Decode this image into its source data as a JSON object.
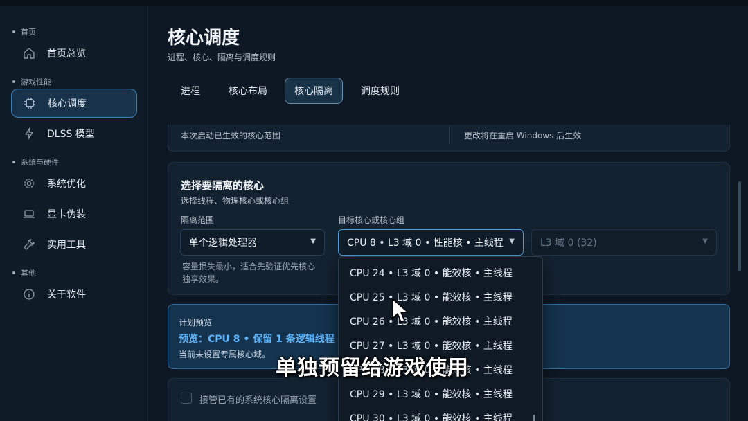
{
  "sidebar": {
    "sections": [
      {
        "label": "首页"
      },
      {
        "label": "游戏性能"
      },
      {
        "label": "系统与硬件"
      },
      {
        "label": "其他"
      }
    ],
    "items": [
      {
        "label": "首页总览",
        "icon": "home-icon"
      },
      {
        "label": "核心调度",
        "icon": "chip-icon"
      },
      {
        "label": "DLSS 模型",
        "icon": "lightning-icon"
      },
      {
        "label": "系统优化",
        "icon": "gear-icon"
      },
      {
        "label": "显卡伪装",
        "icon": "laptop-icon"
      },
      {
        "label": "实用工具",
        "icon": "wrench-icon"
      },
      {
        "label": "关于软件",
        "icon": "info-icon"
      }
    ],
    "active_index": 1
  },
  "page": {
    "title": "核心调度",
    "subtitle": "进程、核心、隔离与调度规则"
  },
  "tabs": [
    {
      "label": "进程"
    },
    {
      "label": "核心布局"
    },
    {
      "label": "核心隔离"
    },
    {
      "label": "调度规则"
    }
  ],
  "active_tab": 2,
  "status_card": {
    "left_text": "本次启动已生效的核心范围",
    "right_text": "更改将在重启 Windows 后生效"
  },
  "isolation_card": {
    "title": "选择要隔离的核心",
    "subtitle": "选择线程、物理核心或核心组",
    "scope_label": "隔离范围",
    "scope_value": "单个逻辑处理器",
    "scope_hint_line1": "容量损失最小，适合先验证优先核心",
    "scope_hint_line2": "独享效果。",
    "target_label": "目标核心或核心组",
    "target_value": "CPU 8 • L3 域 0 • 性能核 • 主线程",
    "domain_value": "L3 域 0 (32)"
  },
  "preview_card": {
    "label": "计划预览",
    "preview_text": "预览：CPU 8 • 保留 1 条逻辑线程 •",
    "note": "当前未设置专属核心域。"
  },
  "dropdown": {
    "options": [
      "CPU 24 • L3 域 0 • 能效核 • 主线程",
      "CPU 25 • L3 域 0 • 能效核 • 主线程",
      "CPU 26 • L3 域 0 • 能效核 • 主线程",
      "CPU 27 • L3 域 0 • 能效核 • 主线程",
      "CPU 28 • L3 域 0 • 能效核 • 主线程",
      "CPU 29 • L3 域 0 • 能效核 • 主线程",
      "CPU 30 • L3 域 0 • 能效核 • 主线程"
    ]
  },
  "takeover": {
    "label": "接管已有的系统核心隔离设置"
  },
  "caption": "单独预留给游戏使用",
  "colors": {
    "background": "#0d1824",
    "accent": "#4ea0e0",
    "preview_text": "#5fb6ff"
  }
}
